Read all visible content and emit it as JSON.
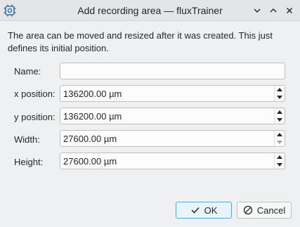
{
  "window": {
    "title": "Add recording area — fluxTrainer",
    "app_icon": "gear-chip-icon",
    "controls": [
      "chevron-down-icon",
      "chevron-up-icon",
      "close-icon"
    ]
  },
  "description": {
    "line1": "The area can be moved and resized after it was created. This just",
    "line2": "defines its initial position."
  },
  "form": {
    "name": {
      "label": "Name:",
      "value": ""
    },
    "x_position": {
      "label": "x position:",
      "value": "136200.00 µm"
    },
    "y_position": {
      "label": "y position:",
      "value": "136200.00 µm"
    },
    "width": {
      "label": "Width:",
      "value": "27600.00 µm"
    },
    "height": {
      "label": "Height:",
      "value": "27600.00 µm"
    }
  },
  "buttons": {
    "ok": "OK",
    "cancel": "Cancel"
  },
  "colors": {
    "accent": "#3daee9",
    "window_bg": "#eff0f1",
    "text": "#232629"
  }
}
